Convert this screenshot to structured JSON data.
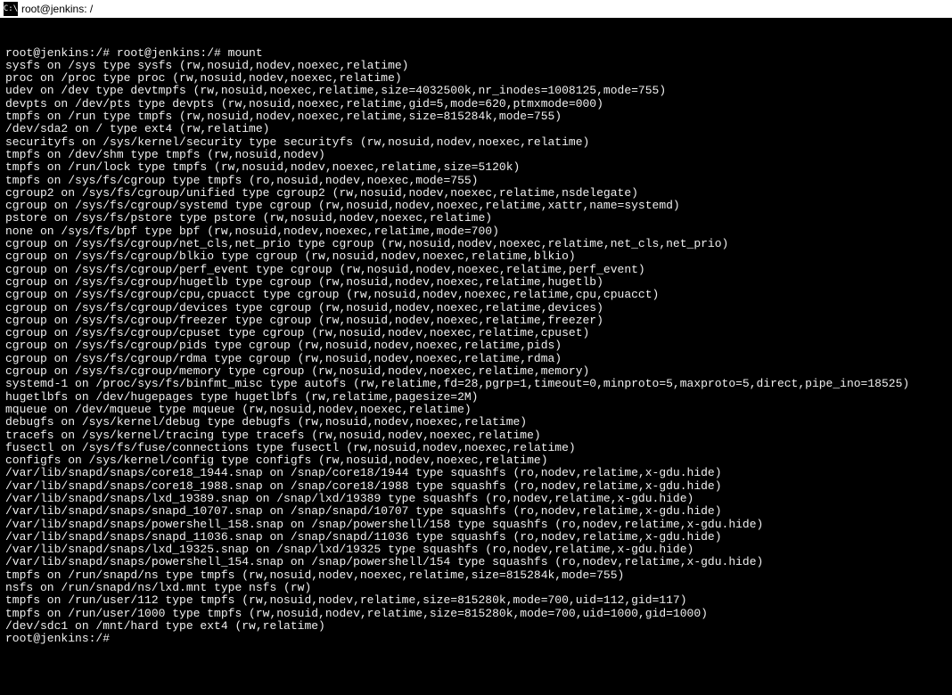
{
  "titlebar": {
    "icon_text": "C:\\",
    "title": "root@jenkins: /"
  },
  "terminal": {
    "lines": [
      "root@jenkins:/# root@jenkins:/# mount",
      "sysfs on /sys type sysfs (rw,nosuid,nodev,noexec,relatime)",
      "proc on /proc type proc (rw,nosuid,nodev,noexec,relatime)",
      "udev on /dev type devtmpfs (rw,nosuid,noexec,relatime,size=4032500k,nr_inodes=1008125,mode=755)",
      "devpts on /dev/pts type devpts (rw,nosuid,noexec,relatime,gid=5,mode=620,ptmxmode=000)",
      "tmpfs on /run type tmpfs (rw,nosuid,nodev,noexec,relatime,size=815284k,mode=755)",
      "/dev/sda2 on / type ext4 (rw,relatime)",
      "securityfs on /sys/kernel/security type securityfs (rw,nosuid,nodev,noexec,relatime)",
      "tmpfs on /dev/shm type tmpfs (rw,nosuid,nodev)",
      "tmpfs on /run/lock type tmpfs (rw,nosuid,nodev,noexec,relatime,size=5120k)",
      "tmpfs on /sys/fs/cgroup type tmpfs (ro,nosuid,nodev,noexec,mode=755)",
      "cgroup2 on /sys/fs/cgroup/unified type cgroup2 (rw,nosuid,nodev,noexec,relatime,nsdelegate)",
      "cgroup on /sys/fs/cgroup/systemd type cgroup (rw,nosuid,nodev,noexec,relatime,xattr,name=systemd)",
      "pstore on /sys/fs/pstore type pstore (rw,nosuid,nodev,noexec,relatime)",
      "none on /sys/fs/bpf type bpf (rw,nosuid,nodev,noexec,relatime,mode=700)",
      "cgroup on /sys/fs/cgroup/net_cls,net_prio type cgroup (rw,nosuid,nodev,noexec,relatime,net_cls,net_prio)",
      "cgroup on /sys/fs/cgroup/blkio type cgroup (rw,nosuid,nodev,noexec,relatime,blkio)",
      "cgroup on /sys/fs/cgroup/perf_event type cgroup (rw,nosuid,nodev,noexec,relatime,perf_event)",
      "cgroup on /sys/fs/cgroup/hugetlb type cgroup (rw,nosuid,nodev,noexec,relatime,hugetlb)",
      "cgroup on /sys/fs/cgroup/cpu,cpuacct type cgroup (rw,nosuid,nodev,noexec,relatime,cpu,cpuacct)",
      "cgroup on /sys/fs/cgroup/devices type cgroup (rw,nosuid,nodev,noexec,relatime,devices)",
      "cgroup on /sys/fs/cgroup/freezer type cgroup (rw,nosuid,nodev,noexec,relatime,freezer)",
      "cgroup on /sys/fs/cgroup/cpuset type cgroup (rw,nosuid,nodev,noexec,relatime,cpuset)",
      "cgroup on /sys/fs/cgroup/pids type cgroup (rw,nosuid,nodev,noexec,relatime,pids)",
      "cgroup on /sys/fs/cgroup/rdma type cgroup (rw,nosuid,nodev,noexec,relatime,rdma)",
      "cgroup on /sys/fs/cgroup/memory type cgroup (rw,nosuid,nodev,noexec,relatime,memory)",
      "systemd-1 on /proc/sys/fs/binfmt_misc type autofs (rw,relatime,fd=28,pgrp=1,timeout=0,minproto=5,maxproto=5,direct,pipe_ino=18525)",
      "hugetlbfs on /dev/hugepages type hugetlbfs (rw,relatime,pagesize=2M)",
      "mqueue on /dev/mqueue type mqueue (rw,nosuid,nodev,noexec,relatime)",
      "debugfs on /sys/kernel/debug type debugfs (rw,nosuid,nodev,noexec,relatime)",
      "tracefs on /sys/kernel/tracing type tracefs (rw,nosuid,nodev,noexec,relatime)",
      "fusectl on /sys/fs/fuse/connections type fusectl (rw,nosuid,nodev,noexec,relatime)",
      "configfs on /sys/kernel/config type configfs (rw,nosuid,nodev,noexec,relatime)",
      "/var/lib/snapd/snaps/core18_1944.snap on /snap/core18/1944 type squashfs (ro,nodev,relatime,x-gdu.hide)",
      "/var/lib/snapd/snaps/core18_1988.snap on /snap/core18/1988 type squashfs (ro,nodev,relatime,x-gdu.hide)",
      "/var/lib/snapd/snaps/lxd_19389.snap on /snap/lxd/19389 type squashfs (ro,nodev,relatime,x-gdu.hide)",
      "/var/lib/snapd/snaps/snapd_10707.snap on /snap/snapd/10707 type squashfs (ro,nodev,relatime,x-gdu.hide)",
      "/var/lib/snapd/snaps/powershell_158.snap on /snap/powershell/158 type squashfs (ro,nodev,relatime,x-gdu.hide)",
      "/var/lib/snapd/snaps/snapd_11036.snap on /snap/snapd/11036 type squashfs (ro,nodev,relatime,x-gdu.hide)",
      "/var/lib/snapd/snaps/lxd_19325.snap on /snap/lxd/19325 type squashfs (ro,nodev,relatime,x-gdu.hide)",
      "/var/lib/snapd/snaps/powershell_154.snap on /snap/powershell/154 type squashfs (ro,nodev,relatime,x-gdu.hide)",
      "tmpfs on /run/snapd/ns type tmpfs (rw,nosuid,nodev,noexec,relatime,size=815284k,mode=755)",
      "nsfs on /run/snapd/ns/lxd.mnt type nsfs (rw)",
      "tmpfs on /run/user/112 type tmpfs (rw,nosuid,nodev,relatime,size=815280k,mode=700,uid=112,gid=117)",
      "tmpfs on /run/user/1000 type tmpfs (rw,nosuid,nodev,relatime,size=815280k,mode=700,uid=1000,gid=1000)",
      "/dev/sdc1 on /mnt/hard type ext4 (rw,relatime)",
      "root@jenkins:/#"
    ]
  }
}
